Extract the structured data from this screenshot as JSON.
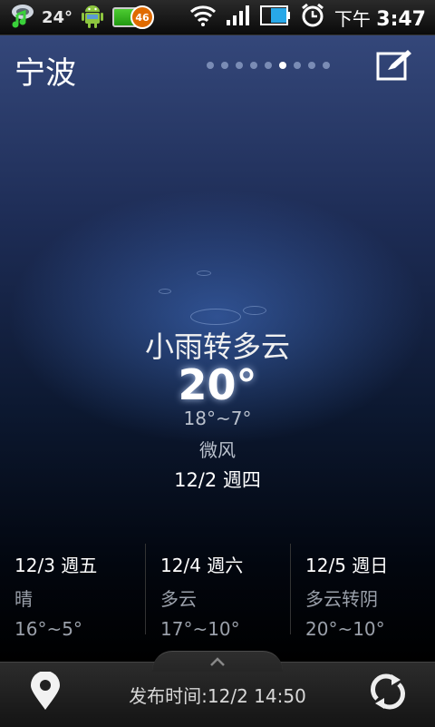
{
  "status_bar": {
    "temperature": "24°",
    "battery_level": "46",
    "time_period": "下午",
    "time": "3:47"
  },
  "header": {
    "city": "宁波",
    "page_count": 9,
    "active_page": 6
  },
  "current": {
    "condition": "小雨转多云",
    "temperature": "20°",
    "range": "18°~7°",
    "wind": "微风",
    "date": "12/2 週四"
  },
  "forecast": [
    {
      "date": "12/3 週五",
      "condition": "晴",
      "range": "16°~5°"
    },
    {
      "date": "12/4 週六",
      "condition": "多云",
      "range": "17°~10°"
    },
    {
      "date": "12/5 週日",
      "condition": "多云转阴",
      "range": "20°~10°"
    }
  ],
  "footer": {
    "published": "发布时间:12/2 14:50"
  },
  "icons": {
    "status_left": [
      "music-weather-icon",
      "android-icon",
      "battery-badge-icon"
    ],
    "status_right": [
      "wifi-icon",
      "signal-icon",
      "battery-icon",
      "alarm-icon"
    ],
    "edit": "edit-icon",
    "location": "location-pin-icon",
    "refresh": "refresh-icon",
    "expand": "chevron-up-icon"
  }
}
